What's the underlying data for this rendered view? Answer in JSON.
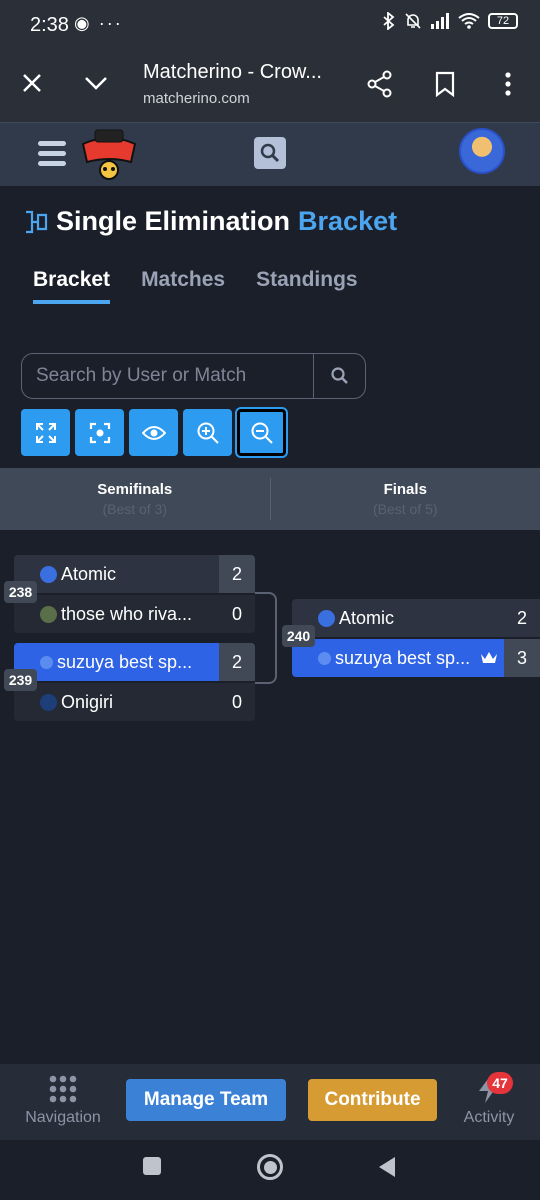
{
  "status_bar": {
    "time": "2:38",
    "left_icons": "◉ ···",
    "battery": "72"
  },
  "browser": {
    "title": "Matcherino - Crow...",
    "url": "matcherino.com"
  },
  "page": {
    "title_main": "Single Elimination",
    "title_accent": "Bracket"
  },
  "tabs": [
    {
      "label": "Bracket",
      "active": true
    },
    {
      "label": "Matches",
      "active": false
    },
    {
      "label": "Standings",
      "active": false
    }
  ],
  "search": {
    "placeholder": "Search by User or Match"
  },
  "rounds": [
    {
      "name": "Semifinals",
      "sub": "(Best of 3)"
    },
    {
      "name": "Finals",
      "sub": "(Best of 5)"
    }
  ],
  "matches": {
    "m238": {
      "number": "238",
      "team1": {
        "name": "Atomic",
        "score": "2"
      },
      "team2": {
        "name": "those who riva...",
        "score": "0"
      }
    },
    "m239": {
      "number": "239",
      "team1": {
        "name": "suzuya best sp...",
        "score": "2"
      },
      "team2": {
        "name": "Onigiri",
        "score": "0"
      }
    },
    "m240": {
      "number": "240",
      "team1": {
        "name": "Atomic",
        "score": "2"
      },
      "team2": {
        "name": "suzuya best sp...",
        "score": "3"
      }
    }
  },
  "bottom_nav": {
    "navigation": "Navigation",
    "manage_team": "Manage Team",
    "contribute": "Contribute",
    "activity": "Activity",
    "activity_badge": "47"
  },
  "colors": {
    "accent": "#4ca5ef",
    "winner_row": "#2e63e6",
    "manage": "#3b82d6",
    "contribute": "#d79b33",
    "badge": "#e6343b"
  }
}
